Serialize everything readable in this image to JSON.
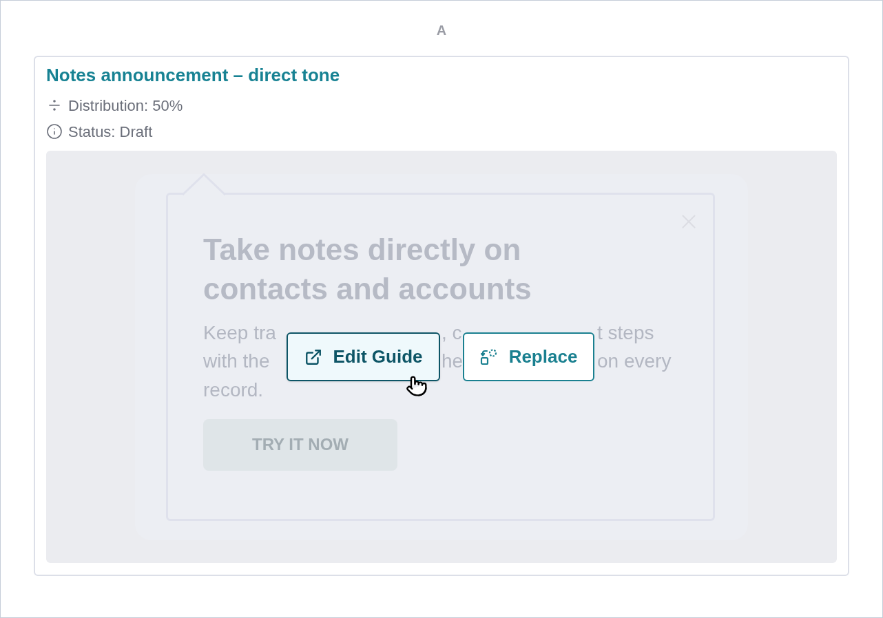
{
  "section_label": "A",
  "variant": {
    "title": "Notes announcement – direct tone",
    "meta": [
      {
        "kind": "distribution",
        "text": "Distribution: 50%"
      },
      {
        "kind": "status",
        "text": "Status: Draft"
      }
    ],
    "preview": {
      "heading_lines": [
        "Take notes directly on",
        "contacts and accounts"
      ],
      "body_lines": [
        [
          "Keep tra",
          ", c",
          "t steps"
        ],
        [
          "with the",
          "he",
          "on every"
        ],
        [
          "record."
        ]
      ],
      "cta": "TRY IT NOW"
    },
    "actions": [
      {
        "kind": "edit",
        "label": "Edit Guide",
        "hovered": true
      },
      {
        "kind": "replace",
        "label": "Replace",
        "hovered": false
      }
    ]
  }
}
